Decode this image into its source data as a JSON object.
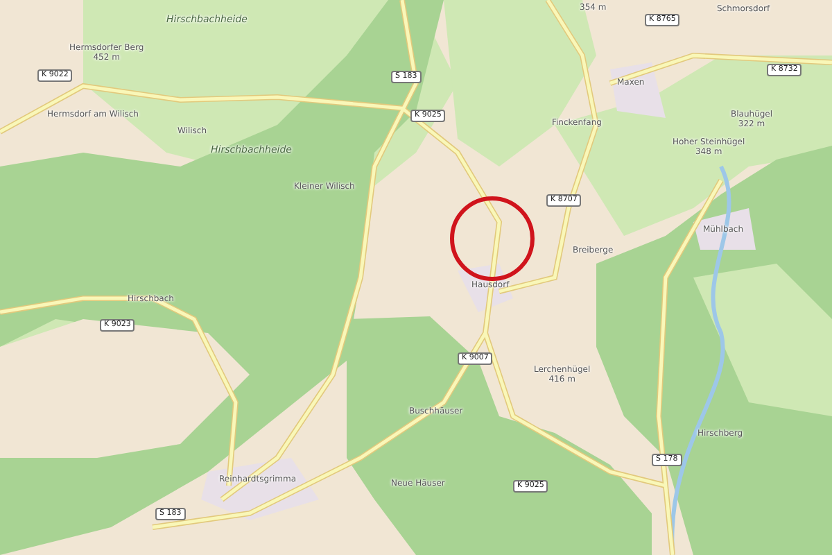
{
  "map": {
    "places": [
      {
        "name": "Hirschbachheide"
      },
      {
        "name": "Hermsdorfer Berg",
        "elevation": "452 m"
      },
      {
        "name": "Hermsdorf am Wilisch"
      },
      {
        "name": "Wilisch"
      },
      {
        "name": "Hirschbachheide"
      },
      {
        "name": "Kleiner Wilisch"
      },
      {
        "name": "Finckenfang"
      },
      {
        "name": "Maxen"
      },
      {
        "name": "Blauhügel",
        "elevation": "322 m"
      },
      {
        "name": "Hoher Steinhügel",
        "elevation": "348 m"
      },
      {
        "name": "Mühlbach"
      },
      {
        "name": "Breiberge"
      },
      {
        "name": "Hausdorf"
      },
      {
        "name": "Lerchenhügel",
        "elevation": "416 m"
      },
      {
        "name": "Hirschbach"
      },
      {
        "name": "Buschhäuser"
      },
      {
        "name": "Neue Häuser"
      },
      {
        "name": "Reinhardtsgrimma"
      },
      {
        "name": "Hirschberg"
      },
      {
        "name": "354 m"
      },
      {
        "name": "Schmorsdorf"
      }
    ],
    "road_shields": [
      "K 9022",
      "S 183",
      "K 9025",
      "K 8765",
      "K 8732",
      "K 8707",
      "K 9023",
      "K 9007",
      "K 9025",
      "S 183",
      "S 178"
    ]
  }
}
